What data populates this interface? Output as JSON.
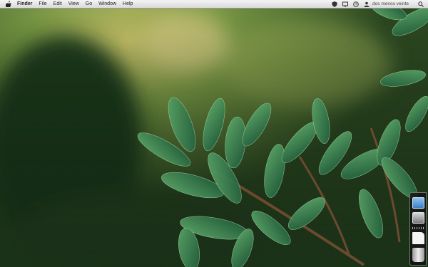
{
  "menubar": {
    "app_name": "Finder",
    "items": [
      "File",
      "Edit",
      "View",
      "Go",
      "Window",
      "Help"
    ],
    "user_name": "dos menos veinte",
    "status_icons": [
      "shield-icon",
      "display-icon",
      "clock-icon",
      "user-icon"
    ],
    "search_icon": "spotlight-search-icon"
  },
  "desktop": {
    "wallpaper": "green-leaves-photo"
  },
  "dock": {
    "items": [
      "finder-icon",
      "system-preferences-icon",
      "stack-separator",
      "document-icon",
      "trash-icon"
    ]
  },
  "colors": {
    "menubar_bg": "#e6e6e6",
    "dock_bg": "#1a1a1a",
    "leaf_green": "#3e7a4a"
  }
}
